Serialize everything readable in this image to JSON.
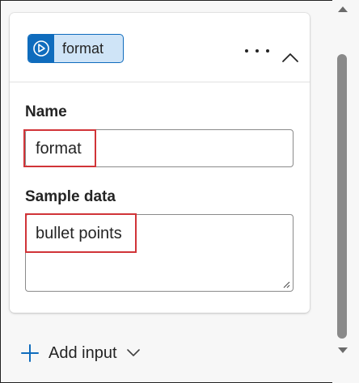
{
  "input_card": {
    "chip_label": "format",
    "chip_icon": "prompt-input-icon",
    "more_icon": "more-horizontal-icon",
    "collapse_icon": "chevron-up-icon",
    "name_label": "Name",
    "name_value": "format",
    "sample_label": "Sample data",
    "sample_value": "bullet points"
  },
  "actions": {
    "add_input_label": "Add input",
    "add_icon": "plus-icon",
    "dropdown_icon": "chevron-down-icon"
  },
  "colors": {
    "accent": "#0f6cbd",
    "chip_background": "#cfe4f7",
    "highlight_red": "#d13438",
    "text": "#242424"
  }
}
